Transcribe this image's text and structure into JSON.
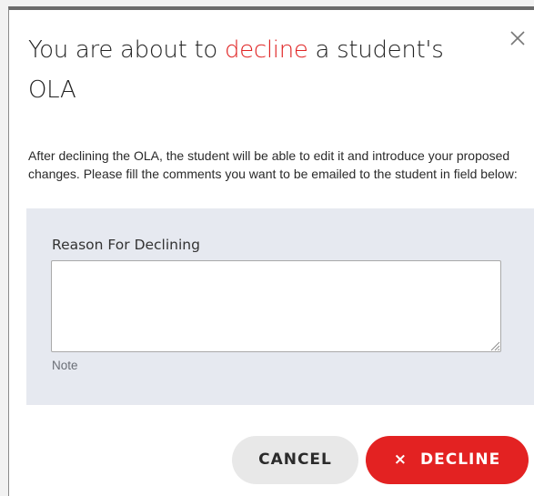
{
  "dialog": {
    "title_prefix": "You are about to ",
    "title_accent": "decline",
    "title_suffix": " a student's OLA",
    "description": "After declining the OLA, the student will be able to edit it and introduce your proposed changes. Please fill the comments you want to be emailed to the student in field below:",
    "close_icon": "close-icon",
    "accent_color": "#e02424"
  },
  "form": {
    "label": "Reason For Declining",
    "value": "",
    "note": "Note"
  },
  "actions": {
    "cancel_label": "CANCEL",
    "decline_icon": "×",
    "decline_label": "DECLINE",
    "decline_color": "#e32222",
    "cancel_color": "#e8e8e8"
  }
}
